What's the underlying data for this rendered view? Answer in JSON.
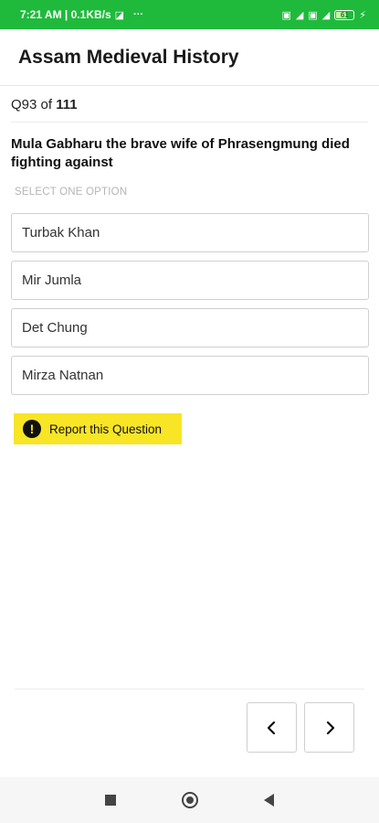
{
  "status_bar": {
    "time_speed": "7:21 AM | 0.1KB/s",
    "more": "···",
    "battery": "61"
  },
  "app": {
    "title": "Assam Medieval History"
  },
  "question": {
    "prefix": "Q",
    "current": "93",
    "of_label": "of",
    "total": "111",
    "text": "Mula Gabharu the brave wife of Phrasengmung died fighting against",
    "hint": "SELECT ONE OPTION",
    "options": [
      "Turbak Khan",
      "Mir Jumla",
      "Det Chung",
      "Mirza Natnan"
    ]
  },
  "report": {
    "label": "Report this Question",
    "icon": "exclamation-icon"
  },
  "navigation": {
    "prev_icon": "chevron-left-icon",
    "next_icon": "chevron-right-icon"
  },
  "colors": {
    "status_bar": "#1fba3c",
    "report_bg": "#f8e526"
  }
}
